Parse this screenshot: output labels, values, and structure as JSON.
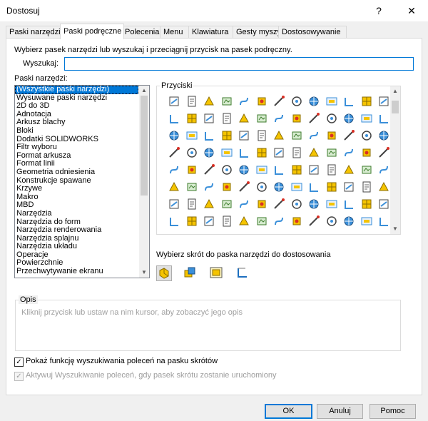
{
  "window": {
    "title": "Dostosuj",
    "help_label": "?",
    "close_label": "✕"
  },
  "tabs": [
    "Paski narzędzi",
    "Paski podręczne",
    "Polecenia",
    "Menu",
    "Klawiatura",
    "Gesty myszy",
    "Dostosowywanie"
  ],
  "active_tab": "Paski podręczne",
  "instruction": "Wybierz pasek narzędzi lub wyszukaj i przeciągnij przycisk na pasek podręczny.",
  "search": {
    "label": "Wyszukaj:",
    "value": ""
  },
  "toolbars": {
    "label": "Paski narzędzi:",
    "items": [
      "(Wszystkie paski narzędzi)",
      "Wysuwane paski narzędzi",
      "2D do 3D",
      "Adnotacja",
      "Arkusz blachy",
      "Bloki",
      "Dodatki SOLIDWORKS",
      "Filtr wyboru",
      "Format arkusza",
      "Format linii",
      "Geometria odniesienia",
      "Konstrukcje spawane",
      "Krzywe",
      "Makro",
      "MBD",
      "Narzędzia",
      "Narzędzia do form",
      "Narzędzia renderowania",
      "Narzędzia splajnu",
      "Narzędzia układu",
      "Operacje",
      "Powierzchnie",
      "Przechwytywanie ekranu"
    ],
    "selected_index": 0
  },
  "buttons_group": {
    "label": "Przyciski"
  },
  "shortcut": {
    "label": "Wybierz skrót do paska narzędzi do dostosowania",
    "icons": [
      "part-shortcut-icon",
      "assembly-shortcut-icon",
      "drawing-shortcut-icon",
      "sketch-shortcut-icon"
    ]
  },
  "description": {
    "label": "Opis",
    "placeholder": "Kliknij przycisk lub ustaw na nim kursor, aby zobaczyć jego opis"
  },
  "checkboxes": [
    {
      "label": "Pokaż funkcję wyszukiwania poleceń na pasku skrótów",
      "checked": true,
      "enabled": true
    },
    {
      "label": "Aktywuj Wyszukiwanie poleceń, gdy pasek skrótu zostanie uruchomiony",
      "checked": true,
      "enabled": false
    }
  ],
  "footer": {
    "ok_label": "OK",
    "cancel_label": "Anuluj",
    "help_label": "Pomoc"
  },
  "colors": {
    "accent": "#0078d7",
    "icon_yellow": "#f5c400",
    "icon_blue": "#3a8fd9",
    "icon_red": "#d93025"
  }
}
